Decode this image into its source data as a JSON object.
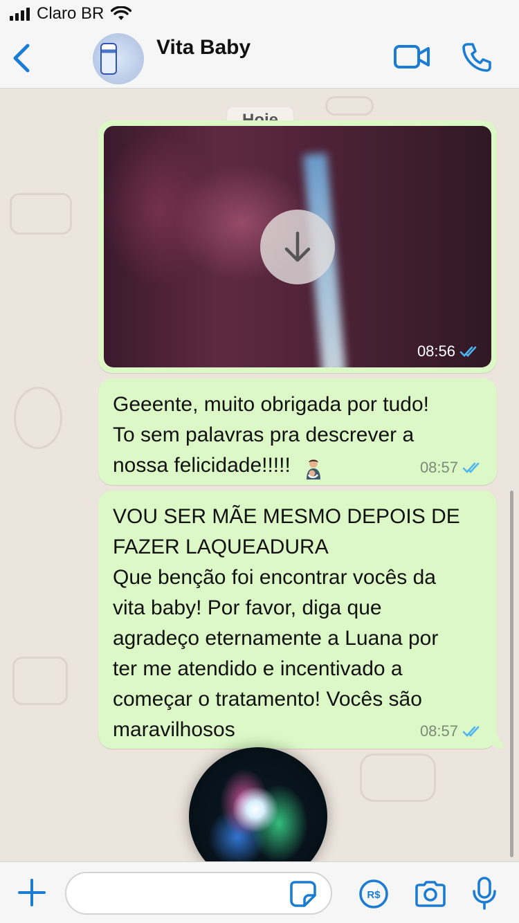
{
  "status_bar": {
    "carrier": "Claro BR"
  },
  "header": {
    "contact_name": "Vita Baby",
    "icons": [
      "back-chevron-icon",
      "video-call-icon",
      "phone-call-icon"
    ]
  },
  "chat": {
    "date_chip": "Hoje",
    "messages": [
      {
        "type": "media",
        "time": "08:56",
        "status": "read"
      },
      {
        "type": "text",
        "text": "Geeente, muito obrigada por tudo!\nTo sem palavras pra descrever a\nnossa felicidade!!!!!",
        "emoji": "breastfeeding",
        "time": "08:57",
        "status": "read"
      },
      {
        "type": "text",
        "text": "VOU SER MÃE MESMO DEPOIS DE\nFAZER LAQUEADURA\nQue benção foi encontrar vocês da\nvita baby! Por favor, diga que\nagradeço eternamente a Luana por\nter me atendido e incentivado a\ncomeçar o tratamento! Vocês são\nmaravilhosos",
        "time": "08:57",
        "status": "read"
      }
    ]
  },
  "input_bar": {
    "placeholder": "",
    "icons": [
      "plus-icon",
      "sticker-icon",
      "pay-icon",
      "camera-icon",
      "microphone-icon"
    ]
  },
  "colors": {
    "accent": "#1a7cd3",
    "bubble_out": "#dcf8c6",
    "chat_bg": "#ece5dd",
    "read_tick": "#4fb5f0"
  }
}
